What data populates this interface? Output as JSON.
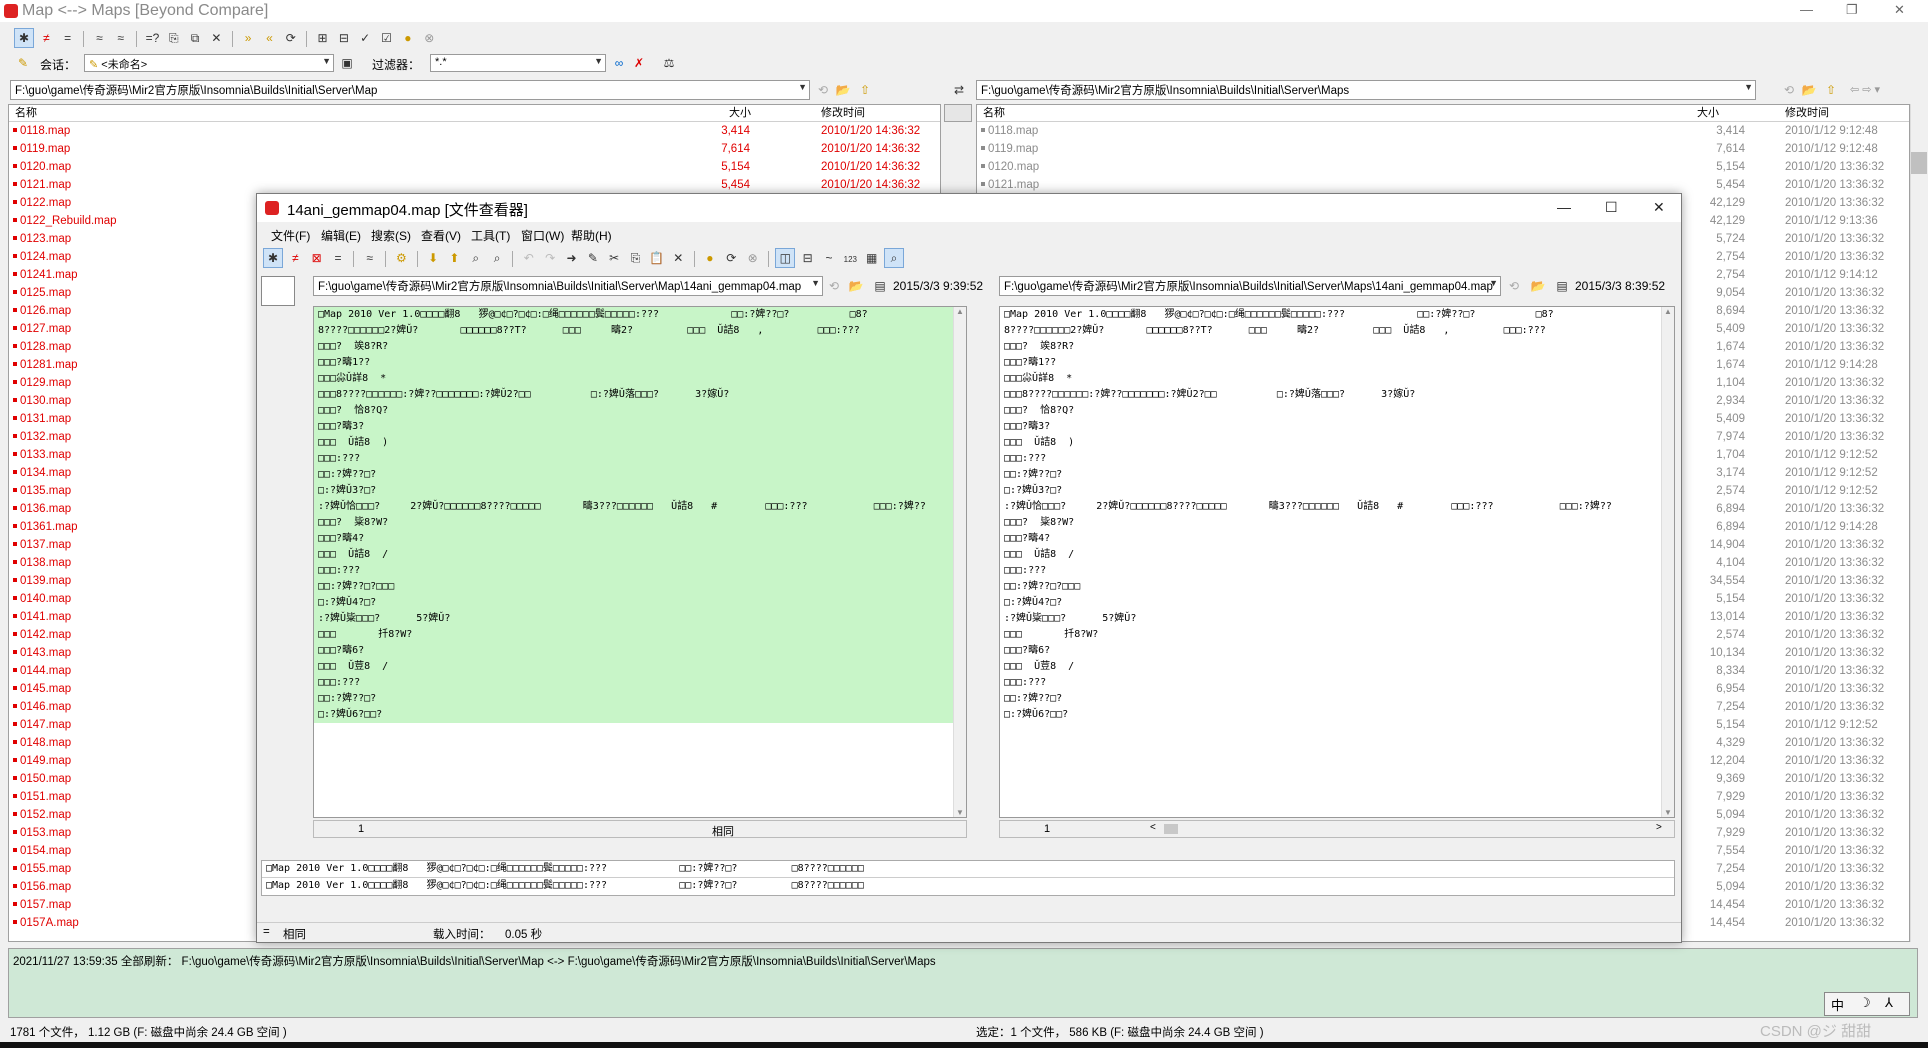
{
  "app": {
    "title": "Map <--> Maps  [Beyond Compare]",
    "controls": {
      "minimize": "—",
      "maximize": "❐",
      "close": "✕"
    }
  },
  "toolbar1": {
    "icons": [
      "all-icon",
      "diffs-icon",
      "filter-icon",
      "equal-icon",
      "unimportant-icon",
      "same-icon",
      "changes-icon",
      "copy-icon",
      "move-icon",
      "delete-icon",
      "rules-icon",
      "expand-icon",
      "collapse-icon",
      "select-icon",
      "check-icon",
      "find-icon",
      "stop-icon"
    ]
  },
  "toolbar2": {
    "session_label": "会话：",
    "session_value": "<未命名>",
    "filter_label": "过滤器：",
    "filter_value": "*.*"
  },
  "left_path": "F:\\guo\\game\\传奇源码\\Mir2官方原版\\Insomnia\\Builds\\Initial\\Server\\Map",
  "right_path": "F:\\guo\\game\\传奇源码\\Mir2官方原版\\Insomnia\\Builds\\Initial\\Server\\Maps",
  "columns": {
    "name": "名称",
    "size": "大小",
    "modified": "修改时间"
  },
  "left_files": [
    {
      "name": "0118.map",
      "size": "3,414",
      "time": "2010/1/20 14:36:32"
    },
    {
      "name": "0119.map",
      "size": "7,614",
      "time": "2010/1/20 14:36:32"
    },
    {
      "name": "0120.map",
      "size": "5,154",
      "time": "2010/1/20 14:36:32"
    },
    {
      "name": "0121.map",
      "size": "5,454",
      "time": "2010/1/20 14:36:32"
    },
    {
      "name": "0122.map",
      "size": "",
      "time": ""
    },
    {
      "name": "0122_Rebuild.map",
      "size": "",
      "time": ""
    },
    {
      "name": "0123.map",
      "size": "",
      "time": ""
    },
    {
      "name": "0124.map",
      "size": "",
      "time": ""
    },
    {
      "name": "01241.map",
      "size": "",
      "time": ""
    },
    {
      "name": "0125.map",
      "size": "",
      "time": ""
    },
    {
      "name": "0126.map",
      "size": "",
      "time": ""
    },
    {
      "name": "0127.map",
      "size": "",
      "time": ""
    },
    {
      "name": "0128.map",
      "size": "",
      "time": ""
    },
    {
      "name": "01281.map",
      "size": "",
      "time": ""
    },
    {
      "name": "0129.map",
      "size": "",
      "time": ""
    },
    {
      "name": "0130.map",
      "size": "",
      "time": ""
    },
    {
      "name": "0131.map",
      "size": "",
      "time": ""
    },
    {
      "name": "0132.map",
      "size": "",
      "time": ""
    },
    {
      "name": "0133.map",
      "size": "",
      "time": ""
    },
    {
      "name": "0134.map",
      "size": "",
      "time": ""
    },
    {
      "name": "0135.map",
      "size": "",
      "time": ""
    },
    {
      "name": "0136.map",
      "size": "",
      "time": ""
    },
    {
      "name": "01361.map",
      "size": "",
      "time": ""
    },
    {
      "name": "0137.map",
      "size": "",
      "time": ""
    },
    {
      "name": "0138.map",
      "size": "",
      "time": ""
    },
    {
      "name": "0139.map",
      "size": "",
      "time": ""
    },
    {
      "name": "0140.map",
      "size": "",
      "time": ""
    },
    {
      "name": "0141.map",
      "size": "",
      "time": ""
    },
    {
      "name": "0142.map",
      "size": "",
      "time": ""
    },
    {
      "name": "0143.map",
      "size": "",
      "time": ""
    },
    {
      "name": "0144.map",
      "size": "",
      "time": ""
    },
    {
      "name": "0145.map",
      "size": "",
      "time": ""
    },
    {
      "name": "0146.map",
      "size": "",
      "time": ""
    },
    {
      "name": "0147.map",
      "size": "",
      "time": ""
    },
    {
      "name": "0148.map",
      "size": "",
      "time": ""
    },
    {
      "name": "0149.map",
      "size": "",
      "time": ""
    },
    {
      "name": "0150.map",
      "size": "",
      "time": ""
    },
    {
      "name": "0151.map",
      "size": "",
      "time": ""
    },
    {
      "name": "0152.map",
      "size": "",
      "time": ""
    },
    {
      "name": "0153.map",
      "size": "",
      "time": ""
    },
    {
      "name": "0154.map",
      "size": "",
      "time": ""
    },
    {
      "name": "0155.map",
      "size": "",
      "time": ""
    },
    {
      "name": "0156.map",
      "size": "",
      "time": ""
    },
    {
      "name": "0157.map",
      "size": "",
      "time": ""
    },
    {
      "name": "0157A.map",
      "size": "",
      "time": ""
    }
  ],
  "right_files": [
    {
      "name": "0118.map",
      "size": "3,414",
      "time": "2010/1/12 9:12:48"
    },
    {
      "name": "0119.map",
      "size": "7,614",
      "time": "2010/1/12 9:12:48"
    },
    {
      "name": "0120.map",
      "size": "5,154",
      "time": "2010/1/20 13:36:32"
    },
    {
      "name": "0121.map",
      "size": "5,454",
      "time": "2010/1/20 13:36:32"
    },
    {
      "name": "",
      "size": "42,129",
      "time": "2010/1/20 13:36:32"
    },
    {
      "name": "",
      "size": "42,129",
      "time": "2010/1/12 9:13:36"
    },
    {
      "name": "",
      "size": "5,724",
      "time": "2010/1/20 13:36:32"
    },
    {
      "name": "",
      "size": "2,754",
      "time": "2010/1/20 13:36:32"
    },
    {
      "name": "",
      "size": "2,754",
      "time": "2010/1/12 9:14:12"
    },
    {
      "name": "",
      "size": "9,054",
      "time": "2010/1/20 13:36:32"
    },
    {
      "name": "",
      "size": "8,694",
      "time": "2010/1/20 13:36:32"
    },
    {
      "name": "",
      "size": "5,409",
      "time": "2010/1/20 13:36:32"
    },
    {
      "name": "",
      "size": "1,674",
      "time": "2010/1/20 13:36:32"
    },
    {
      "name": "",
      "size": "1,674",
      "time": "2010/1/12 9:14:28"
    },
    {
      "name": "",
      "size": "1,104",
      "time": "2010/1/20 13:36:32"
    },
    {
      "name": "",
      "size": "2,934",
      "time": "2010/1/20 13:36:32"
    },
    {
      "name": "",
      "size": "5,409",
      "time": "2010/1/20 13:36:32"
    },
    {
      "name": "",
      "size": "7,974",
      "time": "2010/1/20 13:36:32"
    },
    {
      "name": "",
      "size": "1,704",
      "time": "2010/1/12 9:12:52"
    },
    {
      "name": "",
      "size": "3,174",
      "time": "2010/1/12 9:12:52"
    },
    {
      "name": "",
      "size": "2,574",
      "time": "2010/1/12 9:12:52"
    },
    {
      "name": "",
      "size": "6,894",
      "time": "2010/1/20 13:36:32"
    },
    {
      "name": "",
      "size": "6,894",
      "time": "2010/1/12 9:14:28"
    },
    {
      "name": "",
      "size": "14,904",
      "time": "2010/1/20 13:36:32"
    },
    {
      "name": "",
      "size": "4,104",
      "time": "2010/1/20 13:36:32"
    },
    {
      "name": "",
      "size": "34,554",
      "time": "2010/1/20 13:36:32"
    },
    {
      "name": "",
      "size": "5,154",
      "time": "2010/1/20 13:36:32"
    },
    {
      "name": "",
      "size": "13,014",
      "time": "2010/1/20 13:36:32"
    },
    {
      "name": "",
      "size": "2,574",
      "time": "2010/1/20 13:36:32"
    },
    {
      "name": "",
      "size": "10,134",
      "time": "2010/1/20 13:36:32"
    },
    {
      "name": "",
      "size": "8,334",
      "time": "2010/1/20 13:36:32"
    },
    {
      "name": "",
      "size": "6,954",
      "time": "2010/1/20 13:36:32"
    },
    {
      "name": "",
      "size": "7,254",
      "time": "2010/1/20 13:36:32"
    },
    {
      "name": "",
      "size": "5,154",
      "time": "2010/1/12 9:12:52"
    },
    {
      "name": "",
      "size": "4,329",
      "time": "2010/1/20 13:36:32"
    },
    {
      "name": "",
      "size": "12,204",
      "time": "2010/1/20 13:36:32"
    },
    {
      "name": "",
      "size": "9,369",
      "time": "2010/1/20 13:36:32"
    },
    {
      "name": "",
      "size": "7,929",
      "time": "2010/1/20 13:36:32"
    },
    {
      "name": "",
      "size": "5,094",
      "time": "2010/1/20 13:36:32"
    },
    {
      "name": "",
      "size": "7,929",
      "time": "2010/1/20 13:36:32"
    },
    {
      "name": "",
      "size": "7,554",
      "time": "2010/1/20 13:36:32"
    },
    {
      "name": "",
      "size": "7,254",
      "time": "2010/1/20 13:36:32"
    },
    {
      "name": "",
      "size": "5,094",
      "time": "2010/1/20 13:36:32"
    },
    {
      "name": "",
      "size": "14,454",
      "time": "2010/1/20 13:36:32"
    },
    {
      "name": "",
      "size": "14,454",
      "time": "2010/1/20 13:36:32"
    }
  ],
  "log": "2021/11/27 13:59:35  全部刷新：  F:\\guo\\game\\传奇源码\\Mir2官方原版\\Insomnia\\Builds\\Initial\\Server\\Map <-> F:\\guo\\game\\传奇源码\\Mir2官方原版\\Insomnia\\Builds\\Initial\\Server\\Maps",
  "status_left": "1781 个文件，  1.12 GB   (F: 磁盘中尚余 24.4 GB 空间 )",
  "status_right": "选定：1 个文件，  586 KB   (F: 磁盘中尚余 24.4 GB 空间 )",
  "watermark": "CSDN @ジ  甜甜",
  "ime": [
    "中",
    "☽",
    "⅄"
  ],
  "viewer": {
    "title": "14ani_gemmap04.map  [文件查看器]",
    "menu": [
      "文件(F)",
      "编辑(E)",
      "搜索(S)",
      "查看(V)",
      "工具(T)",
      "窗口(W)",
      "帮助(H)"
    ],
    "left_path": "F:\\guo\\game\\传奇源码\\Mir2官方原版\\Insomnia\\Builds\\Initial\\Server\\Map\\14ani_gemmap04.map",
    "left_date": "2015/3/3 9:39:52",
    "right_path": "F:\\guo\\game\\传奇源码\\Mir2官方原版\\Insomnia\\Builds\\Initial\\Server\\Maps\\14ani_gemmap04.map",
    "right_date": "2015/3/3 8:39:52",
    "left_lines": [
      "□Map 2010 Ver 1.0□□□□翻8   猡@□¢□?□¢□:□绳□□□□□□鬓□□□□□:???            □□:?婢??□?          □8?",
      "8????□□□□□□2?婢Ǔ?       □□□□□□8??T?      □□□     疇2?         □□□  Ǔ詰8   ,         □□□:???",
      "□□□?  竢8?R?",
      "□□□?疇1??",
      "□□□尛Ǔ詳8  *",
      "□□□8????□□□□□□:?婢??□□□□□□□:?婢Ǔ2?□□          □:?婢Ǔ落□□□?      3?嫁Ǔ?",
      "□□□?  恰8?Q?",
      "□□□?疇3?",
      "□□□  Ǔ詰8  )",
      "□□□:???",
      "□□:?婢??□?",
      "□:?婢Ǔ3?□?",
      ":?婢Ǔ恰□□□?     2?婢Ǔ?□□□□□□8????□□□□□       疇3???□□□□□□   Ǔ詰8   #        □□□:???           □□□:?婢??",
      "□□□?  粊8?W?",
      "□□□?疇4?",
      "□□□  Ǔ詰8  /",
      "□□□:???",
      "□□:?婢??□?□□□",
      "□:?婢Ǔ4?□?",
      ":?婢Ǔ粊□□□?      5?婢Ǔ?",
      "□□□       扦8?W?",
      "□□□?疇6?",
      "□□□  Ǔ荳8  /",
      "□□□:???",
      "□□:?婢??□?",
      "□:?婢Ǔ6?□□?"
    ],
    "right_lines": [
      "□Map 2010 Ver 1.0□□□□翻8   猡@□¢□?□¢□:□绳□□□□□□鬓□□□□□:???            □□:?婢??□?          □8?",
      "8????□□□□□□2?婢Ǔ?       □□□□□□8??T?      □□□     疇2?         □□□  Ǔ詰8   ,         □□□:???",
      "□□□?  竢8?R?",
      "□□□?疇1??",
      "□□□尛Ǔ詳8  *",
      "□□□8????□□□□□□:?婢??□□□□□□□:?婢Ǔ2?□□          □:?婢Ǔ落□□□?      3?嫁Ǔ?",
      "□□□?  恰8?Q?",
      "□□□?疇3?",
      "□□□  Ǔ詰8  )",
      "□□□:???",
      "□□:?婢??□?",
      "□:?婢Ǔ3?□?",
      ":?婢Ǔ恰□□□?     2?婢Ǔ?□□□□□□8????□□□□□       疇3???□□□□□□   Ǔ詰8   #        □□□:???           □□□:?婢??",
      "□□□?  粊8?W?",
      "□□□?疇4?",
      "□□□  Ǔ詰8  /",
      "□□□:???",
      "□□:?婢??□?□□□",
      "□:?婢Ǔ4?□?",
      ":?婢Ǔ粊□□□?      5?婢Ǔ?",
      "□□□       扦8?W?",
      "□□□?疇6?",
      "□□□  Ǔ荳8  /",
      "□□□:???",
      "□□:?婢??□?",
      "□:?婢Ǔ6?□□?"
    ],
    "left_line_no": "1",
    "right_line_no": "1",
    "compare_status": "相同",
    "detail_line1": "□Map 2010 Ver 1.0□□□□翻8   猡@□¢□?□¢□:□绳□□□□□□鬓□□□□□:???            □□:?婢??□?         □8????□□□□□□",
    "detail_line2": "□Map 2010 Ver 1.0□□□□翻8   猡@□¢□?□¢□:□绳□□□□□□鬓□□□□□:???            □□:?婢??□?         □8????□□□□□□",
    "status_equal": "=",
    "status_same": "相同",
    "load_label": "载入时间：",
    "load_value": "0.05 秒"
  },
  "colors": {
    "diff_red": "#e00000",
    "same_gray": "#8c8c8c",
    "match_green": "#c8f5c8"
  }
}
